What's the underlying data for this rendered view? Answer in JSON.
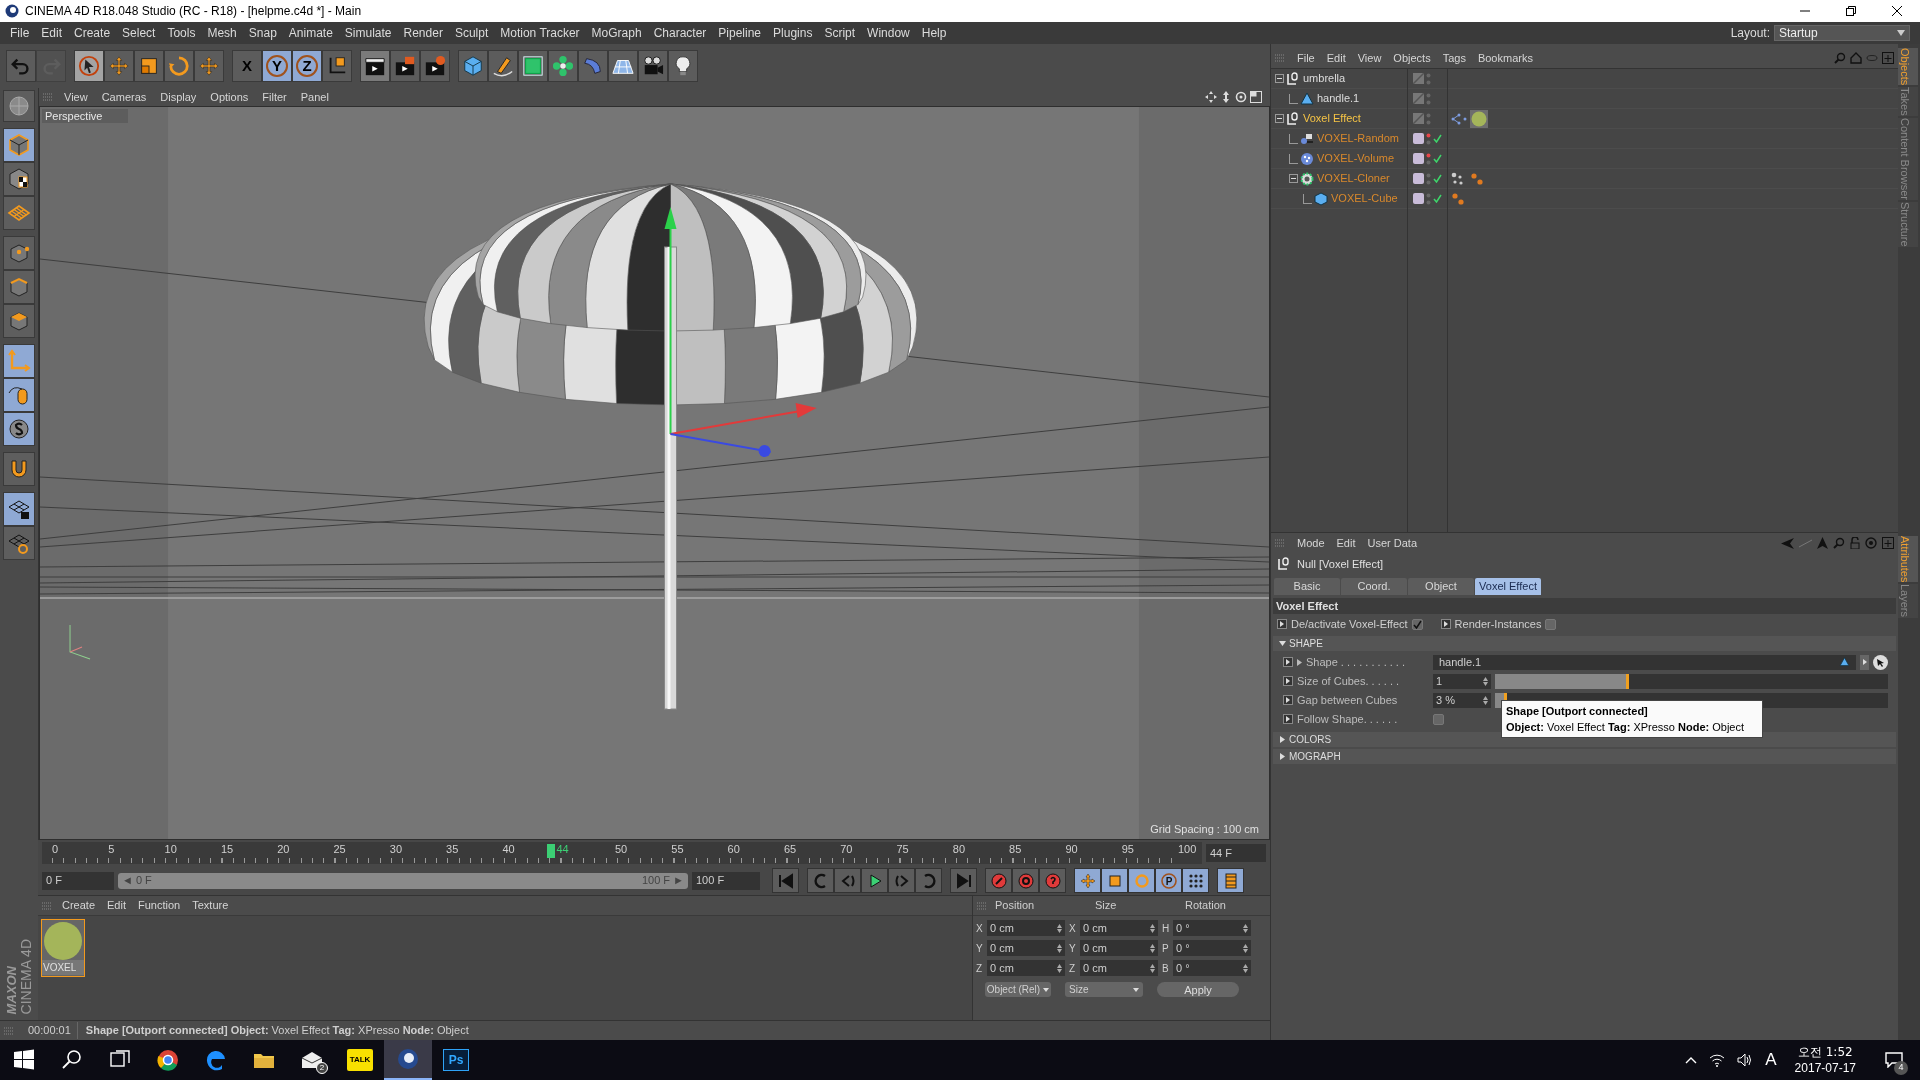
{
  "window": {
    "title": "CINEMA 4D R18.048 Studio (RC - R18) - [helpme.c4d *] - Main"
  },
  "menubar": [
    "File",
    "Edit",
    "Create",
    "Select",
    "Tools",
    "Mesh",
    "Snap",
    "Animate",
    "Simulate",
    "Render",
    "Sculpt",
    "Motion Tracker",
    "MoGraph",
    "Character",
    "Pipeline",
    "Plugins",
    "Script",
    "Window",
    "Help"
  ],
  "layout": {
    "label": "Layout:",
    "value": "Startup"
  },
  "axis_locks": [
    {
      "label": "X",
      "on": false
    },
    {
      "label": "Y",
      "on": true
    },
    {
      "label": "Z",
      "on": true
    }
  ],
  "mode_tools": [
    {
      "kind": "model",
      "active": true
    },
    {
      "kind": "texture",
      "active": false
    },
    {
      "kind": "workplane",
      "active": false
    },
    {
      "kind": "points",
      "active": false
    },
    {
      "kind": "edges",
      "active": false
    },
    {
      "kind": "polygons",
      "active": false
    },
    {
      "kind": "axis",
      "active": true
    },
    {
      "kind": "tweak",
      "active": true
    },
    {
      "kind": "solo",
      "active": true
    },
    {
      "kind": "snap",
      "active": false
    },
    {
      "kind": "gridlock",
      "active": true
    },
    {
      "kind": "planar",
      "active": false
    }
  ],
  "branding": [
    "MAXON",
    "CINEMA 4D"
  ],
  "viewport": {
    "menu": [
      "View",
      "Cameras",
      "Display",
      "Options",
      "Filter",
      "Panel"
    ],
    "camera": "Perspective",
    "grid_spacing": "Grid Spacing : 100 cm"
  },
  "timeline": {
    "ticks": [
      "0",
      "5",
      "10",
      "15",
      "20",
      "25",
      "30",
      "35",
      "40",
      "50",
      "55",
      "60",
      "65",
      "70",
      "75",
      "80",
      "85",
      "90",
      "95",
      "100"
    ],
    "current_frame": "44",
    "level": 0.44,
    "frame_field": "44 F",
    "start_field": "0 F",
    "range": {
      "start": "◄ 0 F",
      "end": "100 F ►",
      "level": 1
    },
    "end_field": "100 F"
  },
  "key_modes": [
    {
      "kind": "position",
      "on": true
    },
    {
      "kind": "scale",
      "on": true
    },
    {
      "kind": "rotation",
      "on": true
    },
    {
      "kind": "parameter",
      "on": true,
      "label": "P"
    },
    {
      "kind": "pla",
      "on": true
    }
  ],
  "material_manager": {
    "menu": [
      "Create",
      "Edit",
      "Function",
      "Texture"
    ],
    "materials": [
      {
        "name": "VOXEL",
        "selected": true
      }
    ]
  },
  "coordinates": {
    "headers": [
      "Position",
      "Size",
      "Rotation"
    ],
    "rows": [
      {
        "axis": "X",
        "position": "0 cm",
        "size_axis": "X",
        "size": "0 cm",
        "rot_axis": "H",
        "rotation": "0 °"
      },
      {
        "axis": "Y",
        "position": "0 cm",
        "size_axis": "Y",
        "size": "0 cm",
        "rot_axis": "P",
        "rotation": "0 °"
      },
      {
        "axis": "Z",
        "position": "0 cm",
        "size_axis": "Z",
        "size": "0 cm",
        "rot_axis": "B",
        "rotation": "0 °"
      }
    ],
    "mode": "Object (Rel)",
    "size_mode": "Size",
    "apply": "Apply"
  },
  "status_bar": {
    "time": "00:00:01",
    "message": "**Shape [Outport connected] Object:** Voxel Effect **Tag:** XPresso **Node:** Object"
  },
  "object_manager": {
    "menu": [
      "File",
      "Edit",
      "View",
      "Objects",
      "Tags",
      "Bookmarks"
    ],
    "objects": [
      {
        "name": "umbrella",
        "kind": "null",
        "selected": false,
        "expanded": true,
        "enabled": false,
        "editor_hidden": false,
        "children": [
          {
            "name": "handle.1",
            "kind": "polygon",
            "selected": false,
            "enabled": false,
            "editor_hidden": false
          }
        ]
      },
      {
        "name": "Voxel Effect",
        "kind": "null",
        "selected": true,
        "expanded": true,
        "enabled": false,
        "editor_hidden": false,
        "tags": [
          {
            "kind": "xpresso"
          },
          {
            "kind": "material"
          }
        ],
        "children": [
          {
            "name": "VOXEL-Random",
            "kind": "random",
            "selected": false,
            "enabled": true,
            "editor_hidden": true,
            "color": "#c9bcd9"
          },
          {
            "name": "VOXEL-Volume",
            "kind": "volume",
            "selected": false,
            "enabled": true,
            "editor_hidden": true,
            "color": "#c9bcd9"
          },
          {
            "name": "VOXEL-Cloner",
            "kind": "cloner",
            "selected": false,
            "expanded": true,
            "enabled": true,
            "editor_hidden": false,
            "color": "#c9bcd9",
            "tags": [
              {
                "kind": "weight"
              },
              {
                "kind": "selection"
              }
            ],
            "children": [
              {
                "name": "VOXEL-Cube",
                "kind": "cube",
                "selected": false,
                "enabled": true,
                "editor_hidden": false,
                "color": "#c9bcd9",
                "tags": [
                  {
                    "kind": "selection"
                  }
                ]
              }
            ]
          }
        ]
      }
    ]
  },
  "attributes": {
    "menu": [
      "Mode",
      "Edit",
      "User Data"
    ],
    "title": "Null [Voxel Effect]",
    "tabs": [
      {
        "label": "Basic",
        "selected": false
      },
      {
        "label": "Coord.",
        "selected": false
      },
      {
        "label": "Object",
        "selected": false
      },
      {
        "label": "Voxel Effect",
        "selected": true
      }
    ],
    "section": "Voxel Effect",
    "toggles": [
      {
        "label": "De/activate Voxel-Effect",
        "checked": true
      },
      {
        "label": "Render-Instances",
        "checked": false
      }
    ],
    "groups": [
      {
        "label": "SHAPE",
        "expanded": true,
        "params": [
          {
            "kind": "link",
            "label": "Shape . . . . . . . . . . .",
            "value": "handle.1",
            "expanded": false
          },
          {
            "kind": "slider",
            "label": "Size of Cubes. . . . . .",
            "value": "1",
            "level": 0.34
          },
          {
            "kind": "slider",
            "label": "Gap between Cubes",
            "value": "3 %",
            "level": 0.03
          },
          {
            "kind": "checkbox",
            "label": "Follow Shape. . . . . .",
            "checked": false
          }
        ]
      },
      {
        "label": "COLORS",
        "expanded": false
      },
      {
        "label": "MOGRAPH",
        "expanded": false
      }
    ],
    "tooltip": {
      "title": "Shape [Outport connected]",
      "body": "**Object:** Voxel Effect **Tag:** XPresso **Node:** Object"
    }
  },
  "side_tabs_top": [
    {
      "label": "Objects",
      "selected": true
    },
    {
      "label": "Takes",
      "selected": false
    },
    {
      "label": "Content Browser",
      "selected": false
    },
    {
      "label": "Structure",
      "selected": false
    }
  ],
  "side_tabs_bottom": [
    {
      "label": "Attributes",
      "selected": true
    },
    {
      "label": "Layers",
      "selected": false
    }
  ],
  "taskbar": {
    "apps": [
      {
        "kind": "start",
        "active": false
      },
      {
        "kind": "search",
        "active": false
      },
      {
        "kind": "taskview",
        "active": false
      },
      {
        "kind": "chrome",
        "active": false
      },
      {
        "kind": "edge",
        "active": false
      },
      {
        "kind": "explorer",
        "active": false
      },
      {
        "kind": "mail",
        "active": false,
        "badge": "2"
      },
      {
        "kind": "talk",
        "active": false,
        "label": "TALK"
      },
      {
        "kind": "cinema",
        "active": true
      },
      {
        "kind": "photoshop",
        "active": false,
        "label": "Ps"
      }
    ],
    "ime": "A",
    "time": "오전 1:52",
    "date": "2017-07-17",
    "notifications": "4"
  }
}
